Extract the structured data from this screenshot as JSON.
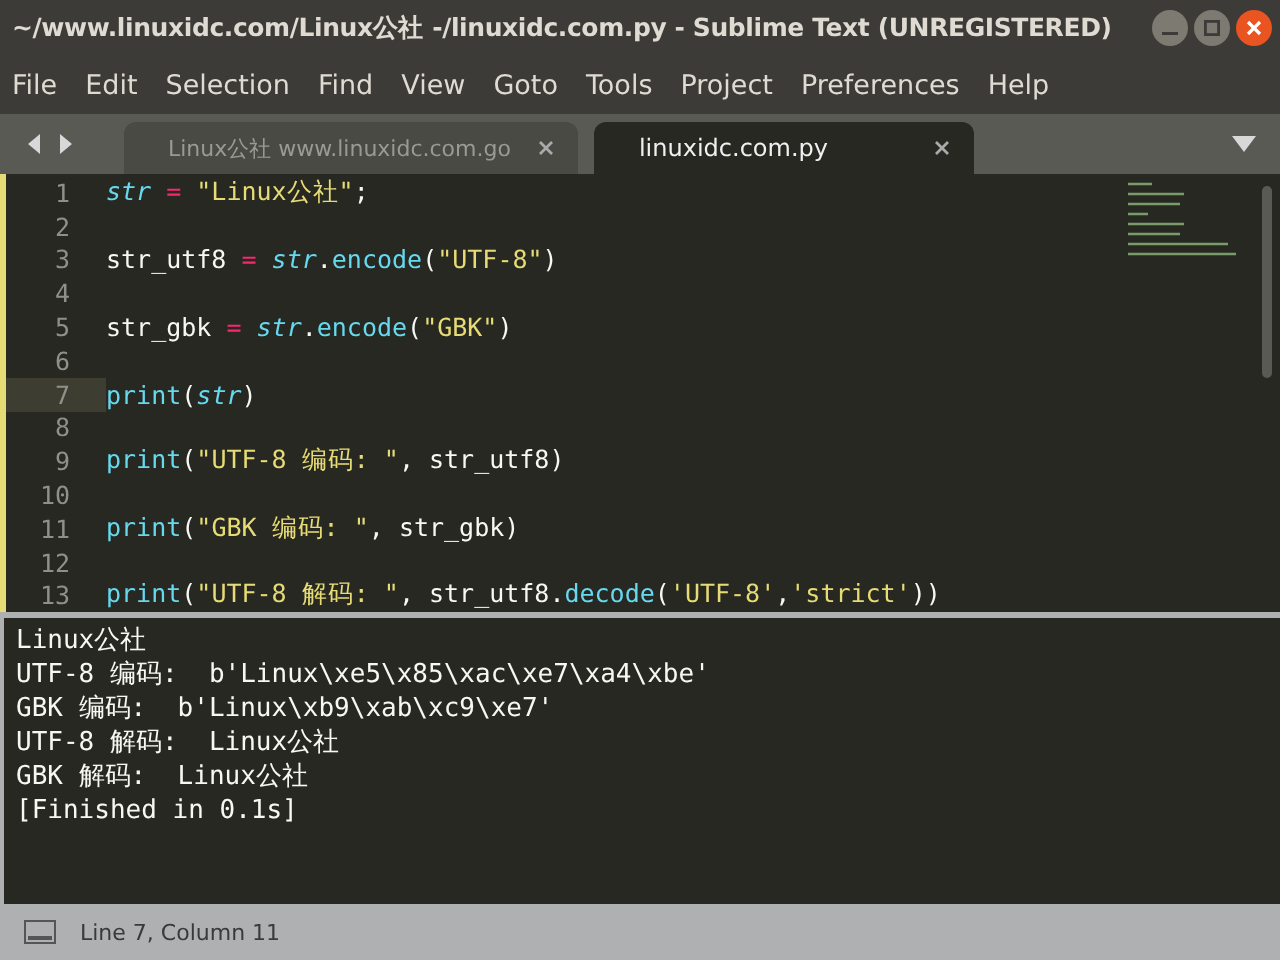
{
  "window": {
    "title": "~/www.linuxidc.com/Linux公社 -/linuxidc.com.py - Sublime Text (UNREGISTERED)"
  },
  "menu": [
    "File",
    "Edit",
    "Selection",
    "Find",
    "View",
    "Goto",
    "Tools",
    "Project",
    "Preferences",
    "Help"
  ],
  "tabs": [
    {
      "label": "Linux公社 www.linuxidc.com.go",
      "selected": false
    },
    {
      "label": "linuxidc.com.py",
      "selected": true
    }
  ],
  "editor": {
    "lines": [
      {
        "number": "1",
        "current": false,
        "tokens": [
          {
            "kind": "var",
            "text": "str"
          },
          {
            "kind": "op",
            "text": " = "
          },
          {
            "kind": "str",
            "text": "\"Linux公社\""
          },
          {
            "kind": "plain",
            "text": ";"
          }
        ]
      },
      {
        "number": "2",
        "current": false
      },
      {
        "number": "3",
        "current": false,
        "tokens": [
          {
            "kind": "plain",
            "text": "str_utf8"
          },
          {
            "kind": "op",
            "text": " = "
          },
          {
            "kind": "var",
            "text": "str"
          },
          {
            "kind": "plain",
            "text": "."
          },
          {
            "kind": "fn",
            "text": "encode"
          },
          {
            "kind": "plain",
            "text": "("
          },
          {
            "kind": "str",
            "text": "\"UTF-8\""
          },
          {
            "kind": "plain",
            "text": ")"
          }
        ]
      },
      {
        "number": "4",
        "current": false
      },
      {
        "number": "5",
        "current": false,
        "tokens": [
          {
            "kind": "plain",
            "text": "str_gbk"
          },
          {
            "kind": "op",
            "text": " = "
          },
          {
            "kind": "var",
            "text": "str"
          },
          {
            "kind": "plain",
            "text": "."
          },
          {
            "kind": "fn",
            "text": "encode"
          },
          {
            "kind": "plain",
            "text": "("
          },
          {
            "kind": "str",
            "text": "\"GBK\""
          },
          {
            "kind": "plain",
            "text": ")"
          }
        ]
      },
      {
        "number": "6",
        "current": false
      },
      {
        "number": "7",
        "current": true,
        "tokens": [
          {
            "kind": "fn",
            "text": "print"
          },
          {
            "kind": "plain",
            "text": "("
          },
          {
            "kind": "var",
            "text": "str"
          },
          {
            "kind": "plain",
            "text": ")"
          }
        ]
      },
      {
        "number": "8",
        "current": false
      },
      {
        "number": "9",
        "current": false,
        "tokens": [
          {
            "kind": "fn",
            "text": "print"
          },
          {
            "kind": "plain",
            "text": "("
          },
          {
            "kind": "str",
            "text": "\"UTF-8 编码: \""
          },
          {
            "kind": "plain",
            "text": ", str_utf8)"
          }
        ]
      },
      {
        "number": "10",
        "current": false
      },
      {
        "number": "11",
        "current": false,
        "tokens": [
          {
            "kind": "fn",
            "text": "print"
          },
          {
            "kind": "plain",
            "text": "("
          },
          {
            "kind": "str",
            "text": "\"GBK 编码: \""
          },
          {
            "kind": "plain",
            "text": ", str_gbk)"
          }
        ]
      },
      {
        "number": "12",
        "current": false
      },
      {
        "number": "13",
        "current": false,
        "tokens": [
          {
            "kind": "fn",
            "text": "print"
          },
          {
            "kind": "plain",
            "text": "("
          },
          {
            "kind": "str",
            "text": "\"UTF-8 解码: \""
          },
          {
            "kind": "plain",
            "text": ", str_utf8."
          },
          {
            "kind": "fn",
            "text": "decode"
          },
          {
            "kind": "plain",
            "text": "("
          },
          {
            "kind": "str",
            "text": "'UTF-8'"
          },
          {
            "kind": "plain",
            "text": ","
          },
          {
            "kind": "str",
            "text": "'strict'"
          },
          {
            "kind": "plain",
            "text": "))"
          }
        ]
      }
    ]
  },
  "output": [
    "Linux公社",
    "UTF-8 编码:  b'Linux\\xe5\\x85\\xac\\xe7\\xa4\\xbe'",
    "GBK 编码:  b'Linux\\xb9\\xab\\xc9\\xe7'",
    "UTF-8 解码:  Linux公社",
    "GBK 解码:  Linux公社",
    "[Finished in 0.1s]"
  ],
  "status_bar": {
    "position": "Line 7, Column 11"
  }
}
